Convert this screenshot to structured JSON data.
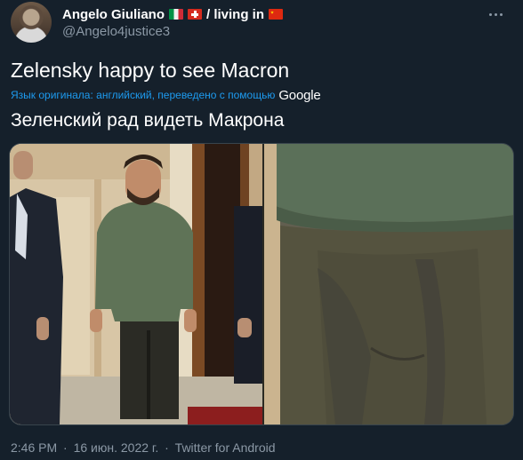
{
  "user": {
    "display_name": "Angelo Giuliano",
    "name_suffix": "/ living in",
    "handle": "@Angelo4justice3",
    "flags": [
      "flag-italy-icon",
      "flag-switzerland-icon",
      "flag-china-icon"
    ]
  },
  "tweet": {
    "text": "Zelensky happy to see Macron",
    "translation_note": "Язык оригинала: английский, переведено с помощью",
    "translation_provider": "Google",
    "translated_text": "Зеленский рад видеть Макрона"
  },
  "media": {
    "photo_count": 2
  },
  "meta": {
    "time": "2:46 PM",
    "date": "16 июн. 2022 г.",
    "separator": "·",
    "source": "Twitter for Android"
  },
  "colors": {
    "background": "#15202b",
    "secondary_text": "#8b98a5",
    "link": "#1d9bf0"
  }
}
